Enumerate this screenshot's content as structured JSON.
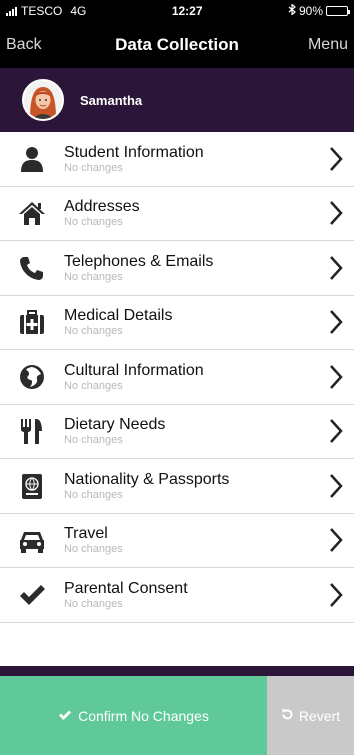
{
  "status_bar": {
    "carrier": "TESCO",
    "network": "4G",
    "time": "12:27",
    "bluetooth_icon": "bluetooth-icon",
    "battery": "90%",
    "battery_level": 0.9
  },
  "nav": {
    "back_label": "Back",
    "title": "Data Collection",
    "menu_label": "Menu"
  },
  "user": {
    "name": "Samantha"
  },
  "items": [
    {
      "label": "Student Information",
      "status": "No changes",
      "icon": "person-icon"
    },
    {
      "label": "Addresses",
      "status": "No changes",
      "icon": "home-icon"
    },
    {
      "label": "Telephones & Emails",
      "status": "No changes",
      "icon": "phone-icon"
    },
    {
      "label": "Medical Details",
      "status": "No changes",
      "icon": "medical-kit-icon"
    },
    {
      "label": "Cultural Information",
      "status": "No changes",
      "icon": "globe-icon"
    },
    {
      "label": "Dietary Needs",
      "status": "No changes",
      "icon": "cutlery-icon"
    },
    {
      "label": "Nationality & Passports",
      "status": "No changes",
      "icon": "passport-icon"
    },
    {
      "label": "Travel",
      "status": "No changes",
      "icon": "car-icon"
    },
    {
      "label": "Parental Consent",
      "status": "No changes",
      "icon": "checkmark-icon"
    }
  ],
  "actions": {
    "confirm_label": "Confirm No Changes",
    "revert_label": "Revert"
  },
  "colors": {
    "header": "#000000",
    "user_bar": "#2b1538",
    "confirm": "#5fc99a",
    "revert": "#c9c9c9"
  }
}
